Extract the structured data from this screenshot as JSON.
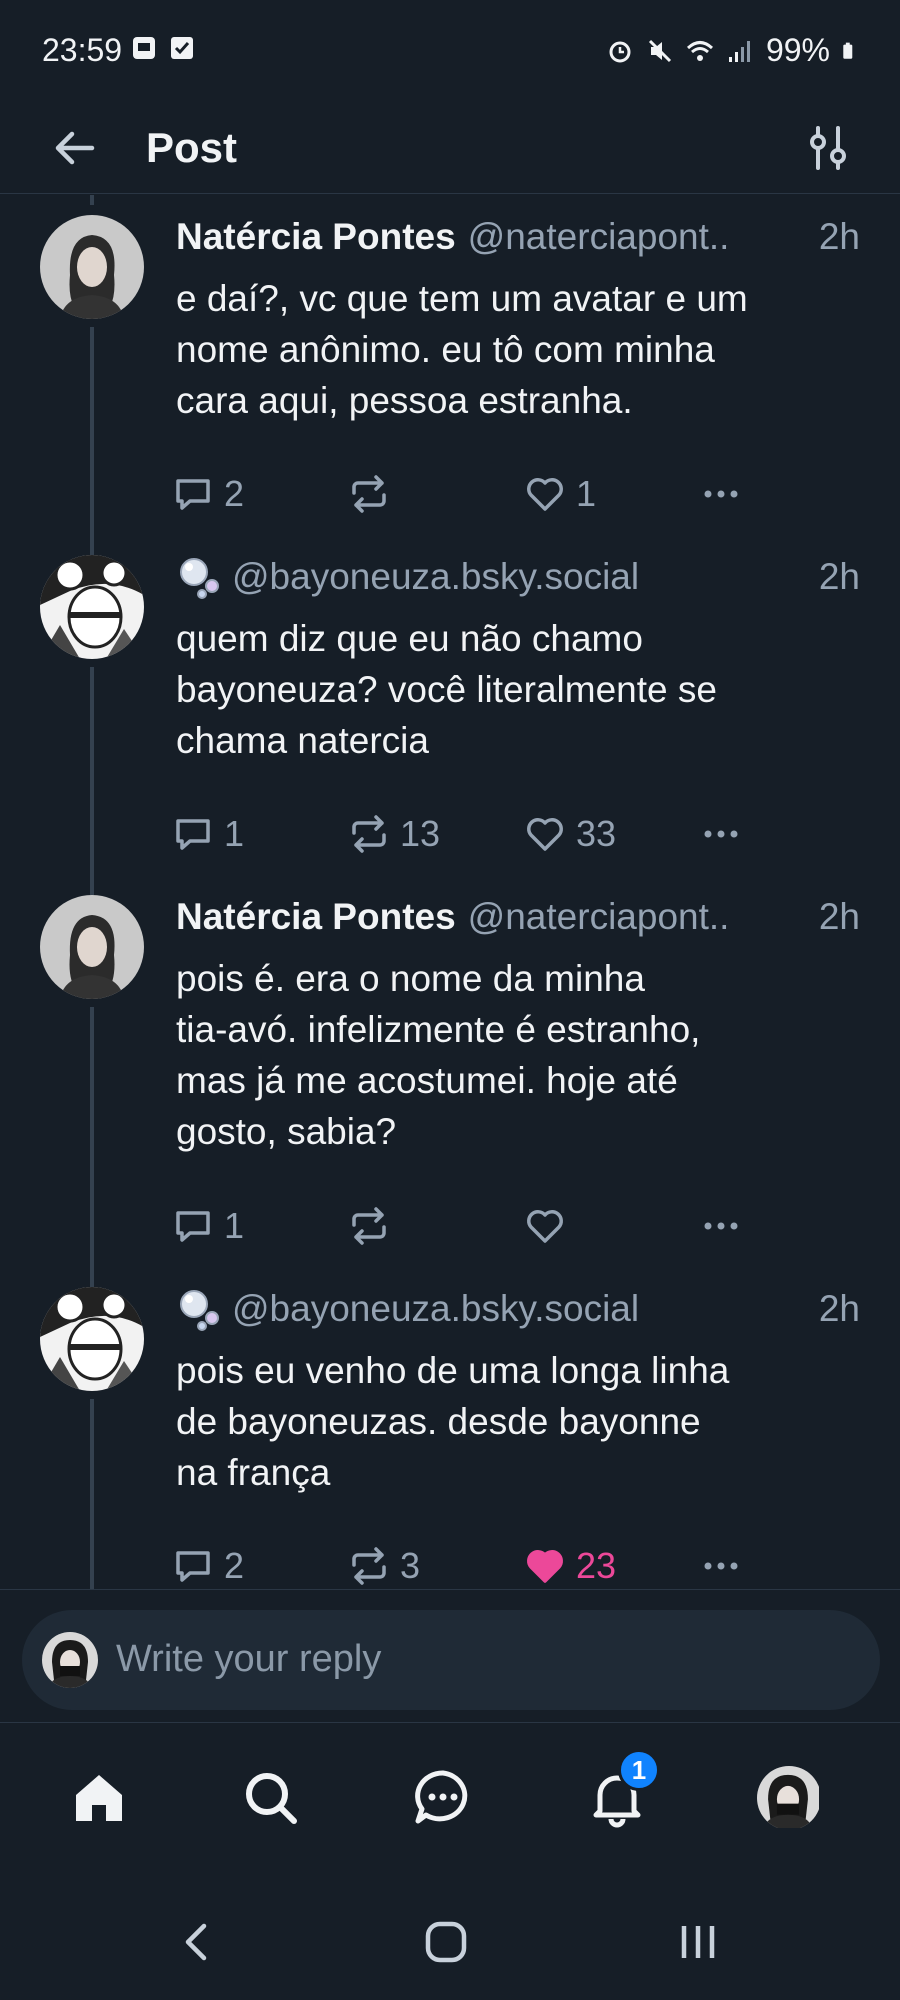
{
  "status_bar": {
    "time": "23:59",
    "battery": "99%"
  },
  "header": {
    "title": "Post"
  },
  "posts": [
    {
      "author": "Natércia Pontes",
      "handle": "@naterciapont..",
      "time": "2h",
      "text": "e daí?, vc que tem um avatar e um\nnome anônimo. eu tô com minha\ncara aqui, pessoa estranha.",
      "replies": "2",
      "reposts": "",
      "likes": "1",
      "liked": false
    },
    {
      "author": "",
      "handle": "@bayoneuza.bsky.social",
      "time": "2h",
      "text": "quem diz que eu não chamo\nbayoneuza? você literalmente se\nchama natercia",
      "replies": "1",
      "reposts": "13",
      "likes": "33",
      "liked": false
    },
    {
      "author": "Natércia Pontes",
      "handle": "@naterciapont..",
      "time": "2h",
      "text": "pois é. era o nome da minha\ntia-avó. infelizmente é estranho,\nmas já me acostumei. hoje até\ngosto, sabia?",
      "replies": "1",
      "reposts": "",
      "likes": "",
      "liked": false
    },
    {
      "author": "",
      "handle": "@bayoneuza.bsky.social",
      "time": "2h",
      "text": "pois eu venho de uma longa linha\nde bayoneuzas. desde bayonne\nna frança",
      "replies": "2",
      "reposts": "3",
      "likes": "23",
      "liked": true
    }
  ],
  "reply_box": {
    "placeholder": "Write your reply"
  },
  "bottom_nav": {
    "notifications_badge": "1"
  },
  "colors": {
    "background": "#161e27",
    "text": "#f1f3f5",
    "muted": "#95a3b3",
    "like_active": "#ec4899",
    "badge": "#1083fe"
  }
}
